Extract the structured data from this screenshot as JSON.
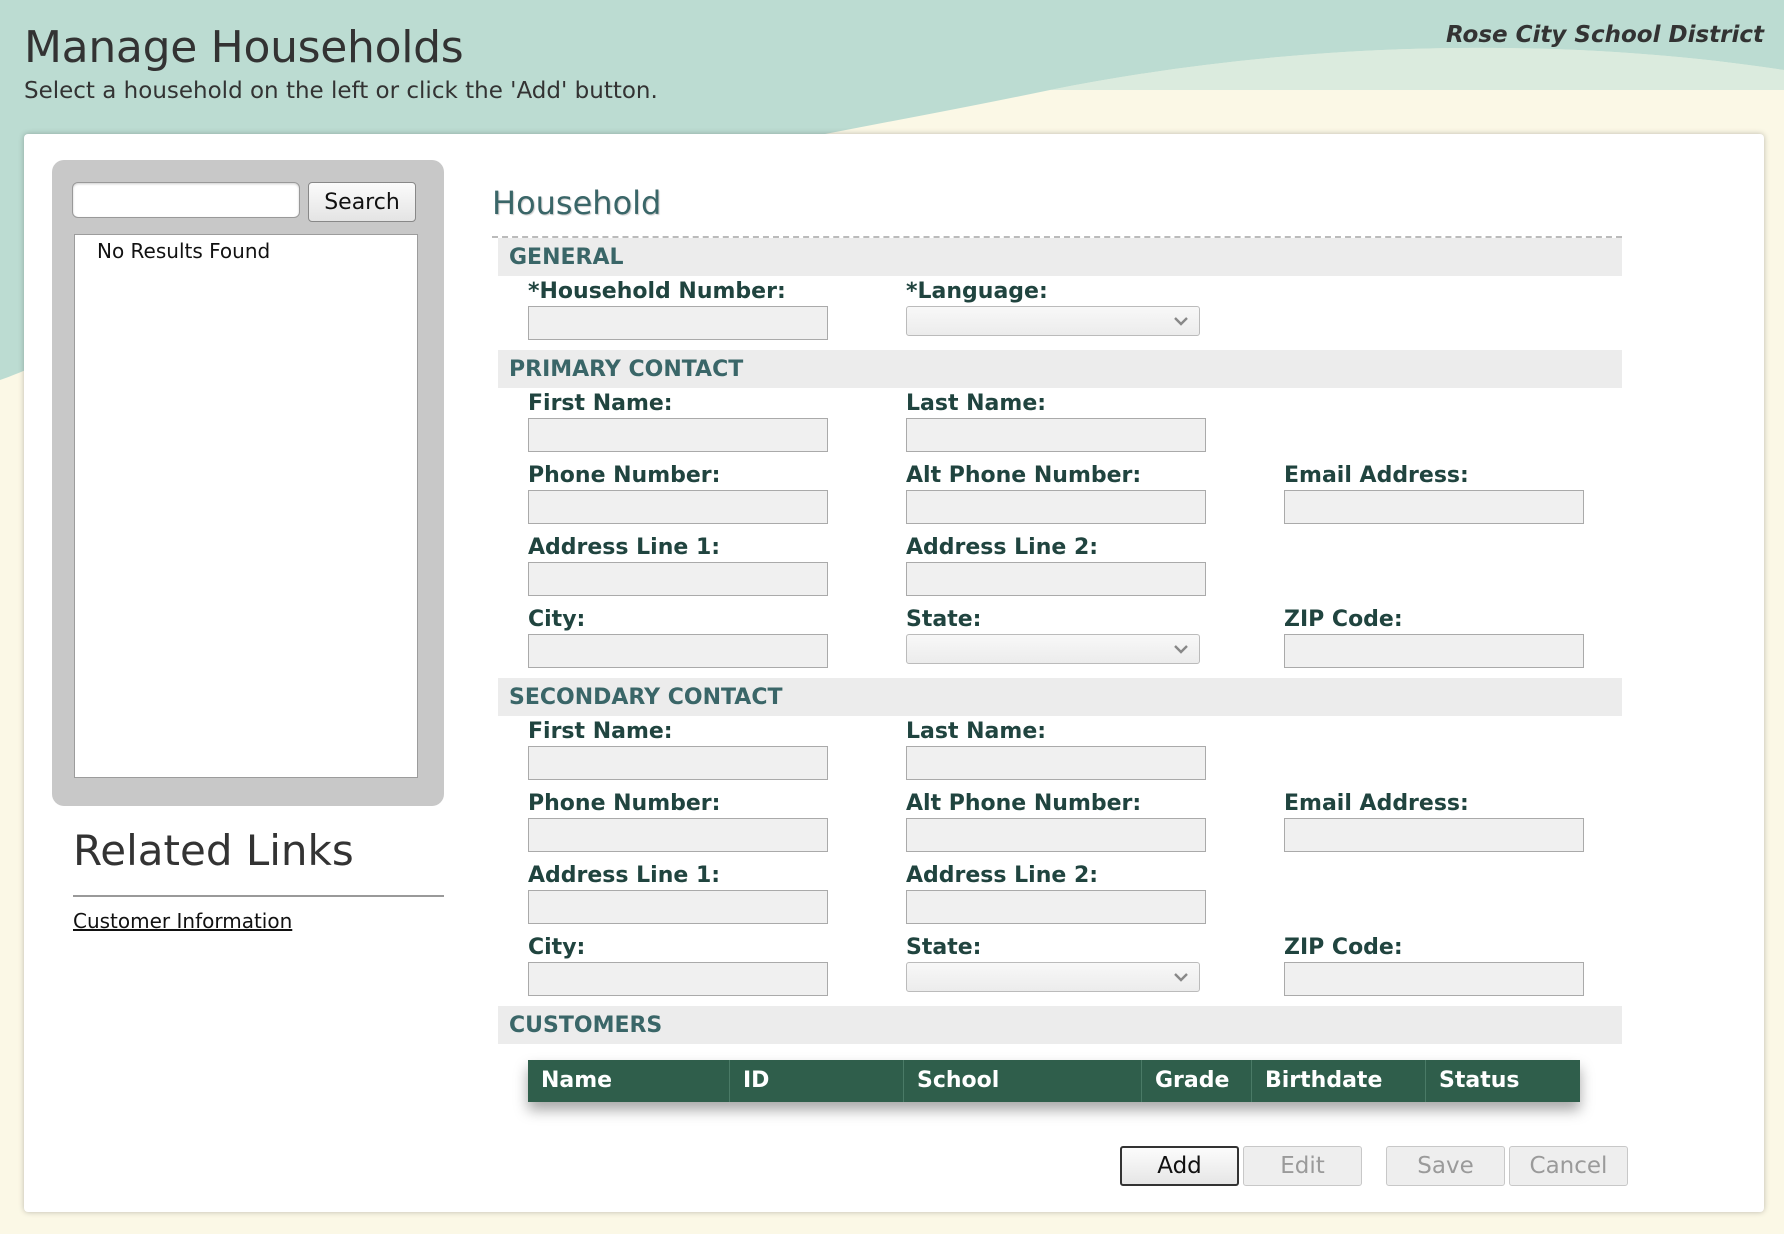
{
  "header": {
    "title": "Manage Households",
    "subtitle": "Select a household on the left or click the 'Add' button.",
    "district": "Rose City School District"
  },
  "sidebar": {
    "search_value": "",
    "search_button_label": "Search",
    "results_empty_text": "No Results Found",
    "related_links_title": "Related Links",
    "related_links": [
      {
        "label": "Customer Information"
      }
    ]
  },
  "form": {
    "title": "Household",
    "general": {
      "section_label": "GENERAL",
      "household_number_label": "*Household Number:",
      "household_number_value": "",
      "language_label": "*Language:",
      "language_value": ""
    },
    "primary_contact": {
      "section_label": "PRIMARY CONTACT",
      "first_name_label": "First Name:",
      "last_name_label": "Last Name:",
      "phone_label": "Phone Number:",
      "alt_phone_label": "Alt Phone Number:",
      "email_label": "Email Address:",
      "address1_label": "Address Line 1:",
      "address2_label": "Address Line 2:",
      "city_label": "City:",
      "state_label": "State:",
      "zip_label": "ZIP Code:"
    },
    "secondary_contact": {
      "section_label": "SECONDARY CONTACT",
      "first_name_label": "First Name:",
      "last_name_label": "Last Name:",
      "phone_label": "Phone Number:",
      "alt_phone_label": "Alt Phone Number:",
      "email_label": "Email Address:",
      "address1_label": "Address Line 1:",
      "address2_label": "Address Line 2:",
      "city_label": "City:",
      "state_label": "State:",
      "zip_label": "ZIP Code:"
    },
    "customers": {
      "section_label": "CUSTOMERS",
      "columns": [
        "Name",
        "ID",
        "School",
        "Grade",
        "Birthdate",
        "Status"
      ],
      "rows": []
    }
  },
  "actions": {
    "add_label": "Add",
    "edit_label": "Edit",
    "save_label": "Save",
    "cancel_label": "Cancel"
  },
  "icons": {
    "select_arrow": "chevron-down-icon"
  },
  "colors": {
    "header_wave": "#bcdcd2",
    "page_background": "#fbf8e6",
    "section_text": "#3a6668",
    "label_text": "#20443f",
    "table_header": "#2f5e4b"
  }
}
